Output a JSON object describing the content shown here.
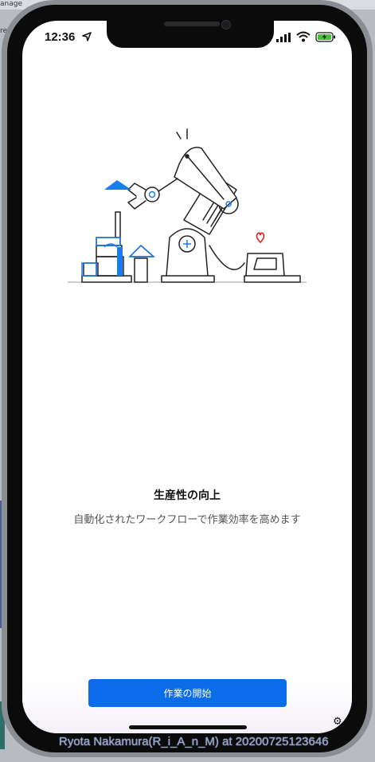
{
  "status_bar": {
    "time": "12:36"
  },
  "onboarding": {
    "title": "生産性の向上",
    "subtitle": "自動化されたワークフローで作業効率を高めます",
    "start_button_label": "作業の開始"
  },
  "icons": {
    "location": "location-arrow-icon",
    "signal": "cellular-signal-icon",
    "wifi": "wifi-icon",
    "battery": "battery-charging-icon",
    "settings": "gear-icon"
  },
  "colors": {
    "accent": "#0a6ce8",
    "illustration_blue": "#1b7cf0",
    "heart": "#e0201b",
    "battery_green": "#37c83a"
  },
  "background_fragments": {
    "top_left": "anage",
    "left_edge": "re"
  },
  "watermark": "Ryota Nakamura(R_i_A_n_M) at 20200725123646"
}
